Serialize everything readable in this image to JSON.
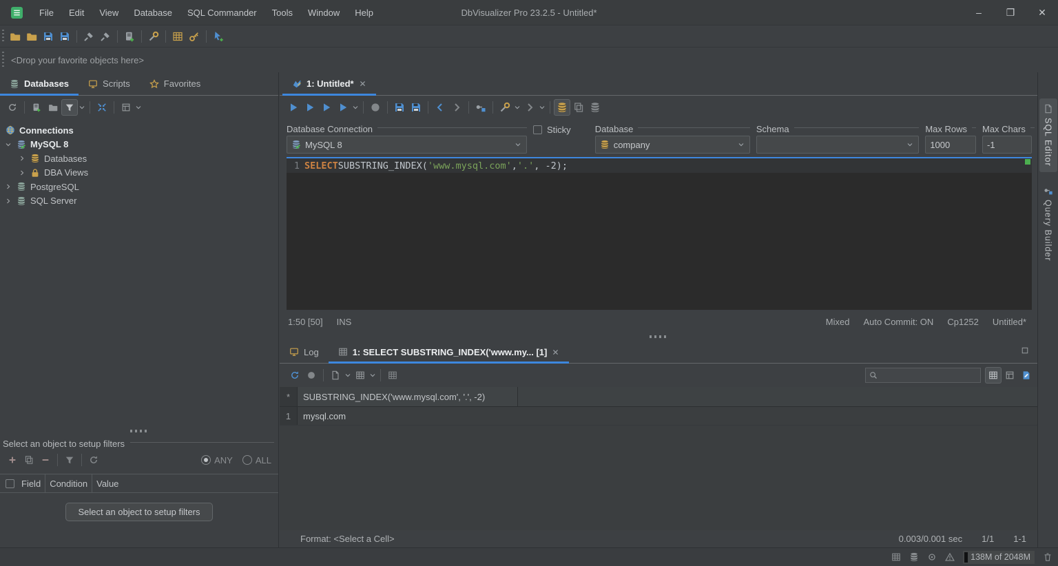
{
  "titlebar": {
    "title": "DbVisualizer Pro 23.2.5 - Untitled*",
    "menus": [
      "File",
      "Edit",
      "View",
      "Database",
      "SQL Commander",
      "Tools",
      "Window",
      "Help"
    ],
    "window_controls": {
      "minimize": "–",
      "restore": "❐",
      "close": "✕"
    }
  },
  "favorites_bar": {
    "text": "<Drop your favorite objects here>"
  },
  "left_panel": {
    "tabs": [
      {
        "label": "Databases"
      },
      {
        "label": "Scripts"
      },
      {
        "label": "Favorites"
      }
    ],
    "tree": {
      "root": "Connections",
      "nodes": [
        {
          "label": "MySQL 8"
        },
        {
          "label": "Databases"
        },
        {
          "label": "DBA Views"
        },
        {
          "label": "PostgreSQL"
        },
        {
          "label": "SQL Server"
        }
      ]
    },
    "filters": {
      "title": "Select an object to setup filters",
      "any": "ANY",
      "all": "ALL",
      "columns": [
        "Field",
        "Condition",
        "Value"
      ],
      "button": "Select an object to setup filters"
    }
  },
  "editor": {
    "tab": "1: Untitled*",
    "labels": {
      "connection": "Database Connection",
      "sticky": "Sticky",
      "database": "Database",
      "schema": "Schema",
      "max_rows": "Max Rows",
      "max_chars": "Max Chars"
    },
    "values": {
      "connection": "MySQL 8",
      "database": "company",
      "schema": "",
      "max_rows": "1000",
      "max_chars": "-1"
    },
    "code": {
      "line_no": "1",
      "kw": "SELECT",
      "fn": " SUBSTRING_INDEX(",
      "s1": "'www.mysql.com'",
      "c1": ", ",
      "s2": "'.'",
      "tail": ", -2);"
    },
    "status": {
      "caret": "1:50 [50]",
      "mode": "INS",
      "mixed": "Mixed",
      "autocommit": "Auto Commit: ON",
      "encoding": "Cp1252",
      "file": "Untitled*"
    }
  },
  "results": {
    "tabs": {
      "log": "Log",
      "result": "1: SELECT SUBSTRING_INDEX('www.my... [1]"
    },
    "grid": {
      "gutter_header": "*",
      "column": "SUBSTRING_INDEX('www.mysql.com', '.', -2)",
      "rows": [
        {
          "n": "1",
          "v": "mysql.com"
        }
      ]
    },
    "status": {
      "format": "Format: <Select a Cell>",
      "timing": "0.003/0.001 sec",
      "rows": "1/1",
      "cell": "1-1"
    }
  },
  "right_sidebar": {
    "tabs": [
      {
        "label": "SQL Editor"
      },
      {
        "label": "Query Builder"
      }
    ]
  },
  "status_bar": {
    "memory": "138M of 2048M"
  }
}
